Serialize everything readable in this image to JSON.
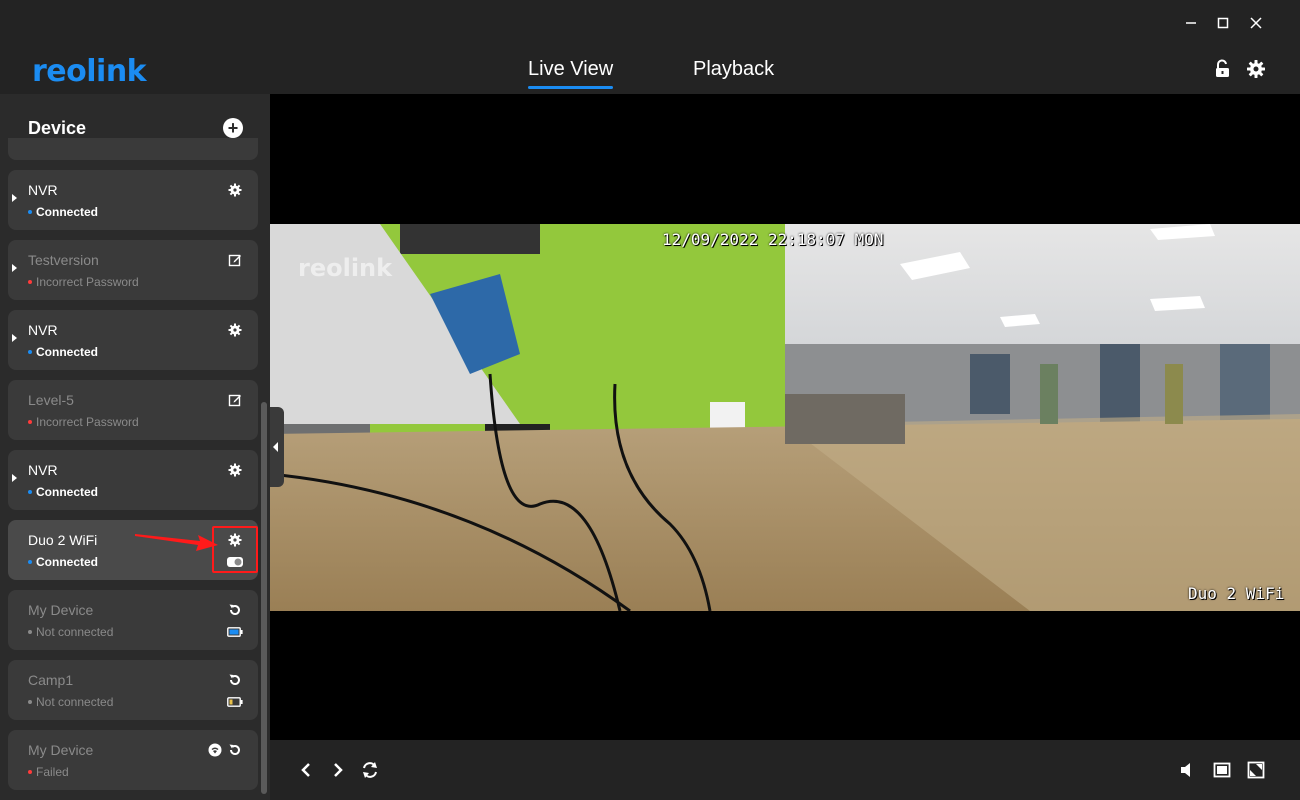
{
  "window": {
    "minimize": "—",
    "maximize": "☐",
    "close": "✕"
  },
  "header": {
    "logo": "reolink",
    "tabs": [
      {
        "label": "Live View",
        "active": true
      },
      {
        "label": "Playback",
        "active": false
      }
    ]
  },
  "sidebar": {
    "title": "Device",
    "devices": [
      {
        "name": "NVR",
        "status": "Connected",
        "status_color": "#1b8cf2",
        "icon": "gear-icon"
      },
      {
        "name": "Testversion",
        "status": "Incorrect Password",
        "status_color": "#ff3b3b",
        "icon": "edit-icon"
      },
      {
        "name": "NVR",
        "status": "Connected",
        "status_color": "#1b8cf2",
        "icon": "gear-icon"
      },
      {
        "name": "Level-5",
        "status": "Incorrect Password",
        "status_color": "#ff3b3b",
        "icon": "edit-icon"
      },
      {
        "name": "NVR",
        "status": "Connected",
        "status_color": "#1b8cf2",
        "icon": "gear-icon"
      },
      {
        "name": "Duo 2 WiFi",
        "status": "Connected",
        "status_color": "#1b8cf2",
        "icon": "gear-icon",
        "secondary_icon": "toggle-icon",
        "selected": true
      },
      {
        "name": "My Device",
        "status": "Not connected",
        "status_color": "#8a8a8a",
        "icon": "refresh-icon",
        "secondary_icon": "battery-icon"
      },
      {
        "name": "Camp1",
        "status": "Not connected",
        "status_color": "#8a8a8a",
        "icon": "refresh-icon",
        "secondary_icon": "battery-icon"
      },
      {
        "name": "My Device",
        "status": "Failed",
        "status_color": "#ff3b3b",
        "icon": "refresh-icon",
        "extra_icon": "wifi-icon"
      }
    ]
  },
  "video": {
    "timestamp": "12/09/2022 22:18:07 MON",
    "watermark": "reolink",
    "camera_name": "Duo 2 WiFi"
  },
  "colors": {
    "accent": "#1b8cf2",
    "error": "#ff3b3b",
    "annotation": "#ff1a1a"
  }
}
